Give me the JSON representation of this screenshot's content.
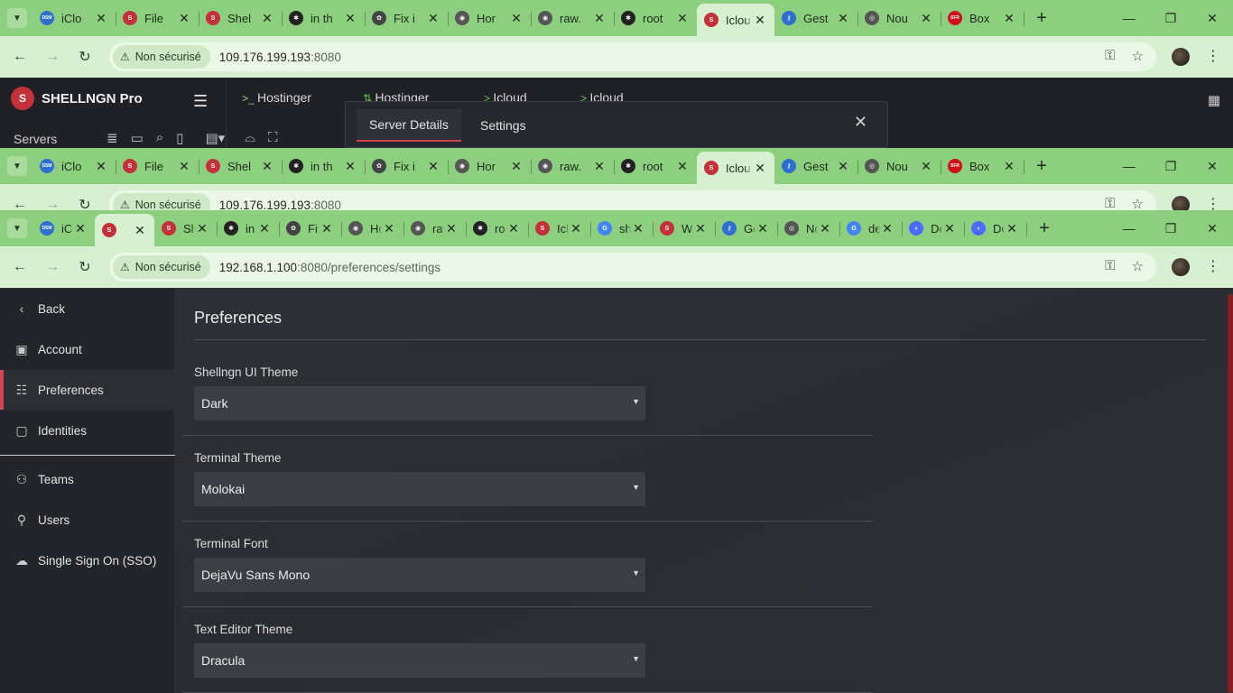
{
  "browser_top": {
    "tabs": [
      {
        "title": "iClo",
        "favicon": "DSM",
        "color": "#2f6fd0"
      },
      {
        "title": "File",
        "favicon": "S",
        "color": "#c4313a"
      },
      {
        "title": "Shel",
        "favicon": "S",
        "color": "#c4313a"
      },
      {
        "title": "in th",
        "favicon": "spider-icon",
        "color": "#222"
      },
      {
        "title": "Fix i",
        "favicon": "openai-icon",
        "color": "#444"
      },
      {
        "title": "Hor",
        "favicon": "globe-icon",
        "color": "#555"
      },
      {
        "title": "raw.",
        "favicon": "globe-icon",
        "color": "#555"
      },
      {
        "title": "root",
        "favicon": "spider-icon",
        "color": "#222"
      },
      {
        "title": "Iclou",
        "favicon": "S",
        "color": "#c4313a",
        "active": true
      },
      {
        "title": "Gest",
        "favicon": "key-icon",
        "color": "#2f6fd0"
      },
      {
        "title": "Nou",
        "favicon": "chrome-icon",
        "color": "#555"
      },
      {
        "title": "Box",
        "favicon": "SFR",
        "color": "#d0101a"
      }
    ],
    "chip": "Non sécurisé",
    "url_host": "109.176.199.193",
    "url_port": ":8080"
  },
  "app": {
    "brand": "SHELLNGN Pro",
    "tabs": [
      "Hostinger",
      "Hostinger",
      "Icloud",
      "Icloud"
    ],
    "servers_label": "Servers",
    "modal": {
      "tab1": "Server Details",
      "tab2": "Settings"
    }
  },
  "browser_mid": {
    "tabs": [
      {
        "title": "iClo",
        "favicon": "DSM",
        "color": "#2f6fd0"
      },
      {
        "title": "File",
        "favicon": "S",
        "color": "#c4313a"
      },
      {
        "title": "Shel",
        "favicon": "S",
        "color": "#c4313a"
      },
      {
        "title": "in th",
        "favicon": "spider-icon",
        "color": "#222"
      },
      {
        "title": "Fix i",
        "favicon": "openai-icon",
        "color": "#444"
      },
      {
        "title": "Hor",
        "favicon": "globe-icon",
        "color": "#555"
      },
      {
        "title": "raw.",
        "favicon": "globe-icon",
        "color": "#555"
      },
      {
        "title": "root",
        "favicon": "spider-icon",
        "color": "#222"
      },
      {
        "title": "Iclou",
        "favicon": "S",
        "color": "#c4313a",
        "active": true
      },
      {
        "title": "Gest",
        "favicon": "key-icon",
        "color": "#2f6fd0"
      },
      {
        "title": "Nou",
        "favicon": "chrome-icon",
        "color": "#555"
      },
      {
        "title": "Box",
        "favicon": "SFR",
        "color": "#d0101a"
      }
    ],
    "chip": "Non sécurisé",
    "url_host": "109.176.199.193",
    "url_port": ":8080"
  },
  "browser_front": {
    "tabs": [
      {
        "title": "iClo",
        "favicon": "DSM",
        "color": "#2f6fd0"
      },
      {
        "title": "",
        "favicon": "S",
        "color": "#c4313a",
        "active": true
      },
      {
        "title": "Shel",
        "favicon": "S",
        "color": "#c4313a"
      },
      {
        "title": "in th",
        "favicon": "spider-icon",
        "color": "#222"
      },
      {
        "title": "Fix i",
        "favicon": "openai-icon",
        "color": "#444"
      },
      {
        "title": "Hor",
        "favicon": "globe-icon",
        "color": "#555"
      },
      {
        "title": "raw.",
        "favicon": "globe-icon",
        "color": "#555"
      },
      {
        "title": "root",
        "favicon": "spider-icon",
        "color": "#222"
      },
      {
        "title": "Iclou",
        "favicon": "S",
        "color": "#c4313a"
      },
      {
        "title": "shel",
        "favicon": "G",
        "color": "#4285f4"
      },
      {
        "title": "Web",
        "favicon": "S",
        "color": "#c4313a"
      },
      {
        "title": "Gest",
        "favicon": "key-icon",
        "color": "#2f6fd0"
      },
      {
        "title": "Nou",
        "favicon": "chrome-icon",
        "color": "#555"
      },
      {
        "title": "deep",
        "favicon": "G",
        "color": "#4285f4"
      },
      {
        "title": "Deep",
        "favicon": "whale-icon",
        "color": "#4d6bfe"
      },
      {
        "title": "Deep",
        "favicon": "whale-icon",
        "color": "#4d6bfe"
      }
    ],
    "chip": "Non sécurisé",
    "url_host": "192.168.1.100",
    "url_path": ":8080/preferences/settings"
  },
  "sidebar": {
    "back": "Back",
    "items": [
      {
        "label": "Account",
        "icon": "account-card-icon"
      },
      {
        "label": "Preferences",
        "icon": "sliders-icon",
        "active": true
      },
      {
        "label": "Identities",
        "icon": "id-badge-icon"
      },
      {
        "label": "Teams",
        "icon": "users-icon"
      },
      {
        "label": "Users",
        "icon": "user-icon"
      },
      {
        "label": "Single Sign On (SSO)",
        "icon": "cloud-lock-icon"
      }
    ]
  },
  "preferences": {
    "title": "Preferences",
    "fields": [
      {
        "label": "Shellngn UI Theme",
        "value": "Dark"
      },
      {
        "label": "Terminal Theme",
        "value": "Molokai"
      },
      {
        "label": "Terminal Font",
        "value": "DejaVu Sans Mono"
      },
      {
        "label": "Text Editor Theme",
        "value": "Dracula"
      }
    ]
  },
  "colors": {
    "tabbar": "#8ccf7e",
    "addrbar": "#d8f0d2",
    "accent": "#d14650"
  }
}
